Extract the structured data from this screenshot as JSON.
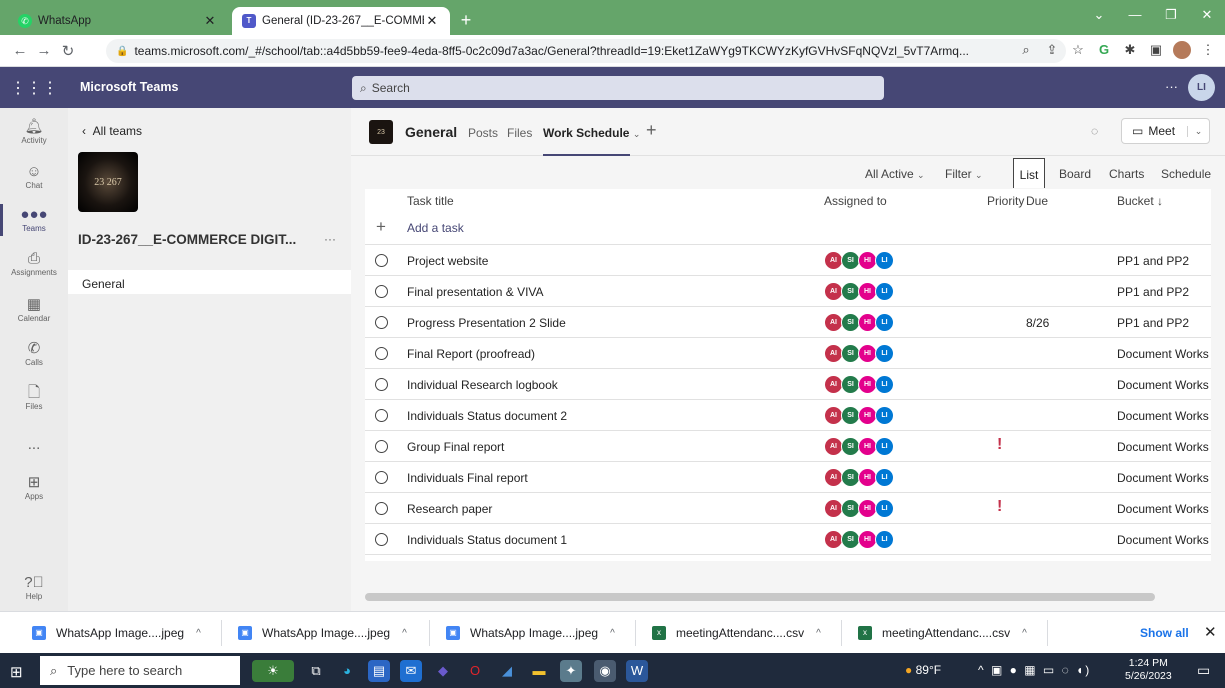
{
  "browser": {
    "tabs": [
      {
        "title": "WhatsApp",
        "icon": "whatsapp-icon"
      },
      {
        "title": "General (ID-23-267__E-COMMER",
        "icon": "teams-icon"
      }
    ],
    "url": "teams.microsoft.com/_#/school/tab::a4d5bb59-fee9-4eda-8ff5-0c2c09d7a3ac/General?threadId=19:Eket1ZaWYg9TKCWYzKyfGVHvSFqNQVzl_5vT7Armq..."
  },
  "teams": {
    "app_name": "Microsoft Teams",
    "search_placeholder": "Search",
    "user_initials": "LI",
    "rail": [
      {
        "label": "Activity",
        "icon": "bell-icon"
      },
      {
        "label": "Chat",
        "icon": "chat-icon"
      },
      {
        "label": "Teams",
        "icon": "teams-icon"
      },
      {
        "label": "Assignments",
        "icon": "assignments-icon"
      },
      {
        "label": "Calendar",
        "icon": "calendar-icon"
      },
      {
        "label": "Calls",
        "icon": "phone-icon"
      },
      {
        "label": "Files",
        "icon": "file-icon"
      },
      {
        "label": "...",
        "icon": "more-icon"
      },
      {
        "label": "Apps",
        "icon": "apps-icon"
      },
      {
        "label": "Help",
        "icon": "help-icon"
      }
    ],
    "all_teams": "All teams",
    "team_name": "ID-23-267__E-COMMERCE DIGIT...",
    "team_logo_text": "23 267",
    "channel": "General"
  },
  "channel_header": {
    "name": "General",
    "tabs": [
      "Posts",
      "Files",
      "Work Schedule"
    ],
    "meet_label": "Meet"
  },
  "planner": {
    "toolbar": {
      "filter_active": "All Active",
      "filter": "Filter",
      "views": [
        "List",
        "Board",
        "Charts",
        "Schedule"
      ]
    },
    "columns": {
      "title": "Task title",
      "assigned": "Assigned to",
      "priority": "Priority",
      "due": "Due",
      "bucket": "Bucket ↓"
    },
    "add_task": "Add a task",
    "assignees": [
      "AI",
      "SI",
      "HI",
      "LI"
    ],
    "tasks": [
      {
        "title": "Project website",
        "priority": "",
        "due": "",
        "bucket": "PP1 and PP2"
      },
      {
        "title": "Final presentation & VIVA",
        "priority": "",
        "due": "",
        "bucket": "PP1 and PP2"
      },
      {
        "title": "Progress Presentation 2 Slide",
        "priority": "",
        "due": "8/26",
        "bucket": "PP1 and PP2"
      },
      {
        "title": "Final Report (proofread)",
        "priority": "",
        "due": "",
        "bucket": "Document Works"
      },
      {
        "title": "Individual Research logbook",
        "priority": "",
        "due": "",
        "bucket": "Document Works"
      },
      {
        "title": "Individuals Status document 2",
        "priority": "",
        "due": "",
        "bucket": "Document Works"
      },
      {
        "title": "Group Final report",
        "priority": "!",
        "due": "",
        "bucket": "Document Works"
      },
      {
        "title": "Individuals Final report",
        "priority": "",
        "due": "",
        "bucket": "Document Works"
      },
      {
        "title": "Research paper",
        "priority": "!",
        "due": "",
        "bucket": "Document Works"
      },
      {
        "title": "Individuals Status document 1",
        "priority": "",
        "due": "",
        "bucket": "Document Works"
      }
    ]
  },
  "downloads": {
    "items": [
      {
        "name": "WhatsApp Image....jpeg",
        "type": "jpeg"
      },
      {
        "name": "WhatsApp Image....jpeg",
        "type": "jpeg"
      },
      {
        "name": "WhatsApp Image....jpeg",
        "type": "jpeg"
      },
      {
        "name": "meetingAttendanc....csv",
        "type": "csv"
      },
      {
        "name": "meetingAttendanc....csv",
        "type": "csv"
      }
    ],
    "show_all": "Show all"
  },
  "taskbar": {
    "search_placeholder": "Type here to search",
    "weather": "89°F",
    "time": "1:24 PM",
    "date": "5/26/2023"
  },
  "colors": {
    "teams_header": "#464775",
    "chrome_frame": "#65a56a",
    "priority_urgent": "#c4314b"
  }
}
